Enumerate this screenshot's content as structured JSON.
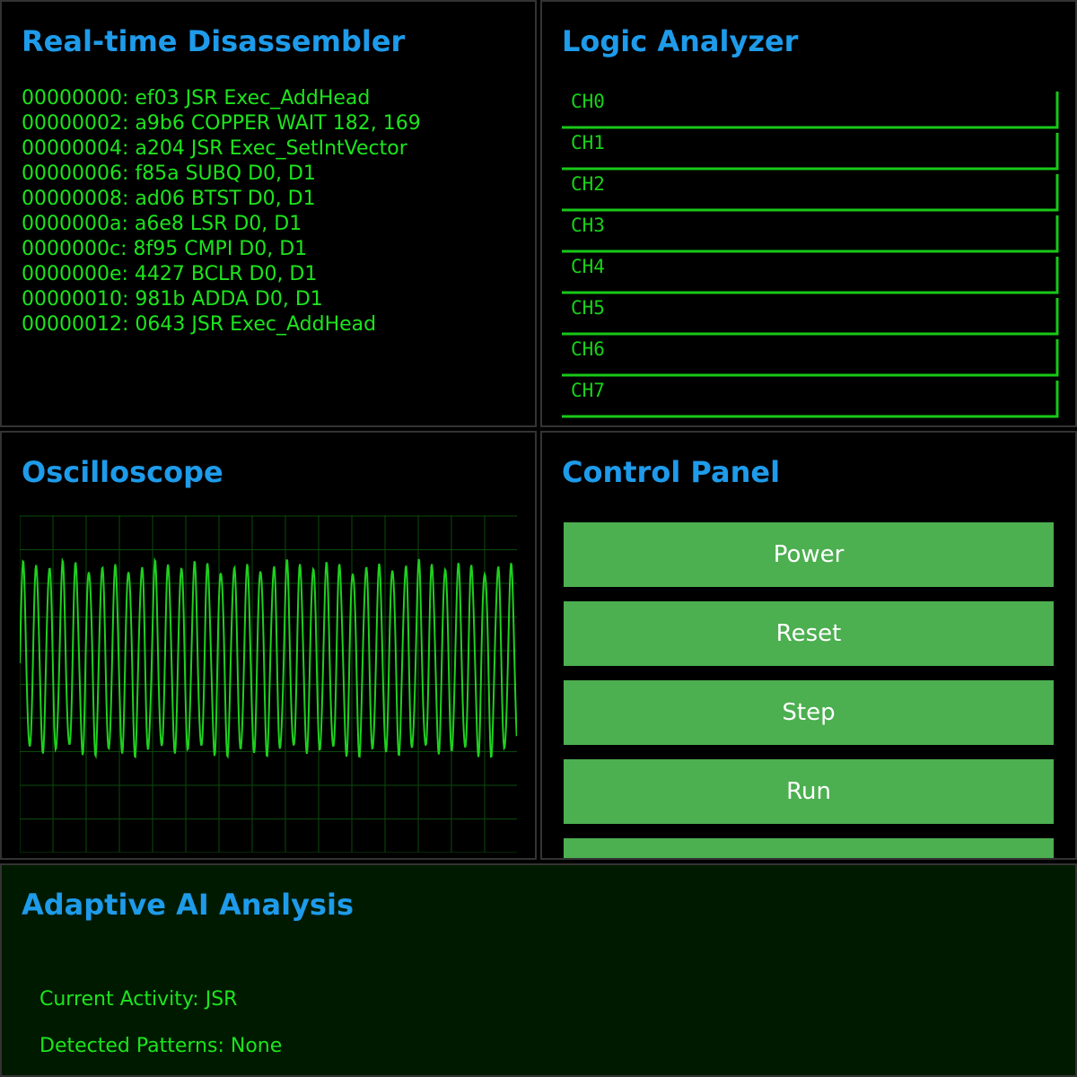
{
  "disassembler": {
    "title": "Real-time Disassembler",
    "lines": [
      "00000000: ef03 JSR Exec_AddHead",
      "00000002: a9b6 COPPER WAIT 182, 169",
      "00000004: a204 JSR Exec_SetIntVector",
      "00000006: f85a SUBQ D0, D1",
      "00000008: ad06 BTST D0, D1",
      "0000000a: a6e8 LSR D0, D1",
      "0000000c: 8f95 CMPI D0, D1",
      "0000000e: 4427 BCLR D0, D1",
      "00000010: 981b ADDA D0, D1",
      "00000012: 0643 JSR Exec_AddHead"
    ]
  },
  "logic_analyzer": {
    "title": "Logic Analyzer",
    "channels": [
      "CH0",
      "CH1",
      "CH2",
      "CH3",
      "CH4",
      "CH5",
      "CH6",
      "CH7"
    ]
  },
  "oscilloscope": {
    "title": "Oscilloscope"
  },
  "control_panel": {
    "title": "Control Panel",
    "buttons": [
      "Power",
      "Reset",
      "Step",
      "Run",
      ""
    ]
  },
  "ai_analysis": {
    "title": "Adaptive AI Analysis",
    "current_activity": "Current Activity: JSR",
    "detected_patterns": "Detected Patterns: None"
  },
  "colors": {
    "title": "#1e9bea",
    "terminal_text": "#1de41d",
    "button": "#4caf50",
    "panel_border": "#333333",
    "ai_background": "#001a00"
  }
}
